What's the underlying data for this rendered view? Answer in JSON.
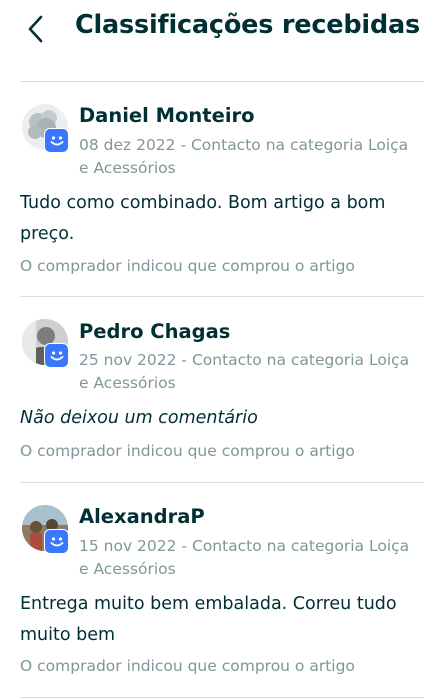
{
  "header": {
    "title": "Classificações recebidas"
  },
  "reviews": [
    {
      "name": "Daniel Monteiro",
      "meta": "08 dez 2022 - Contacto na categoria Loiça e Acessórios",
      "comment": "Tudo como combinado. Bom artigo a bom preço.",
      "note": "O comprador indicou que comprou o artigo"
    },
    {
      "name": "Pedro Chagas",
      "meta": "25 nov 2022 - Contacto na categoria Loiça e Acessórios",
      "comment": "Não deixou um comentário",
      "note": "O comprador indicou que comprou o artigo"
    },
    {
      "name": "AlexandraP",
      "meta": "15 nov 2022 - Contacto na categoria Loiça e Acessórios",
      "comment": "Entrega muito bem embalada. Correu tudo muito bem",
      "note": "O comprador indicou que comprou o artigo"
    }
  ],
  "colors": {
    "primary_text": "#002f34",
    "secondary_text": "#7f9799",
    "badge": "#3a77ff",
    "divider": "#d8dfe0"
  }
}
